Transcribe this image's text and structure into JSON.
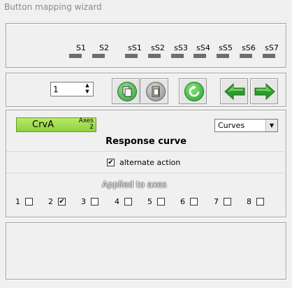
{
  "window": {
    "title": "Button mapping wizard"
  },
  "slots": [
    "S1",
    "S2",
    "sS1",
    "sS2",
    "sS3",
    "sS4",
    "sS5",
    "sS6",
    "sS7"
  ],
  "toolbar": {
    "spin_value": "1",
    "copy_icon": "copy-icon",
    "paste_icon": "paste-icon",
    "reset_icon": "refresh-icon",
    "prev_icon": "arrow-left-icon",
    "next_icon": "arrow-right-icon"
  },
  "curve": {
    "button_label": "CrvA",
    "axes_label": "Axes",
    "axes_value": "2",
    "select_value": "Curves",
    "heading": "Response curve",
    "alternate_label": "alternate action",
    "alternate_checked": true
  },
  "axes": {
    "label": "Applied to axes",
    "items": [
      {
        "num": "1",
        "checked": false
      },
      {
        "num": "2",
        "checked": true
      },
      {
        "num": "3",
        "checked": false
      },
      {
        "num": "4",
        "checked": false
      },
      {
        "num": "5",
        "checked": false
      },
      {
        "num": "6",
        "checked": false
      },
      {
        "num": "7",
        "checked": false
      },
      {
        "num": "8",
        "checked": false
      }
    ]
  },
  "colors": {
    "green_button": "#a6de52",
    "arrow_green": "#2f9a2f",
    "led": "#6e6e6e"
  }
}
